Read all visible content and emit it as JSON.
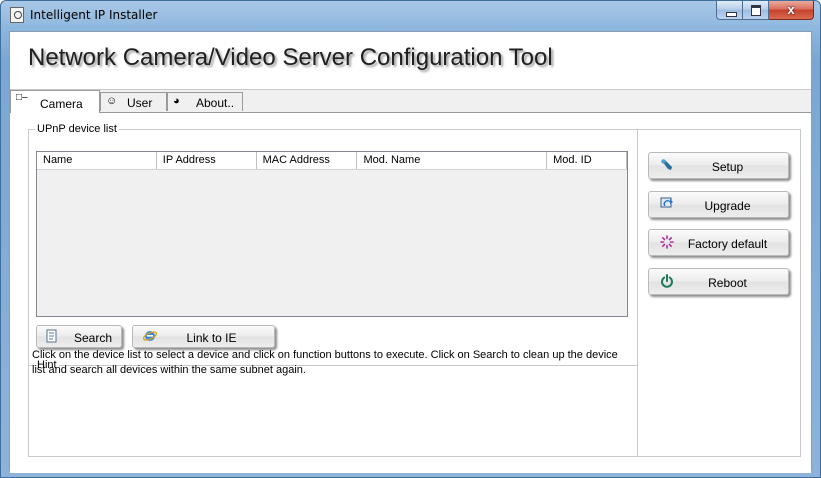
{
  "window": {
    "title": "Intelligent IP Installer",
    "minimize": "",
    "maximize": "",
    "close": "x"
  },
  "header": {
    "title": "Network Camera/Video Server Configuration Tool"
  },
  "tabs": [
    {
      "label": "Camera",
      "icon": "camera-icon",
      "active": true
    },
    {
      "label": "User",
      "icon": "user-icon",
      "active": false
    },
    {
      "label": "About..",
      "icon": "info-icon",
      "active": false
    }
  ],
  "device_list": {
    "group_label": "UPnP device list",
    "columns": [
      "Name",
      "IP Address",
      "MAC Address",
      "Mod. Name",
      "Mod. ID"
    ],
    "rows": []
  },
  "buttons": {
    "search": "Search",
    "link_ie": "Link to IE",
    "setup": "Setup",
    "upgrade": "Upgrade",
    "factory_default": "Factory default",
    "reboot": "Reboot"
  },
  "hint": {
    "label": "Hint",
    "text": "Click on the device list to select a device and click on function buttons to execute. Click on Search to clean up the device list and search all devices  within the same subnet again."
  },
  "colors": {
    "setup_icon": "#2a6f9c",
    "reboot_icon": "#1f7a5c",
    "factory_icon": "#b0309a"
  }
}
